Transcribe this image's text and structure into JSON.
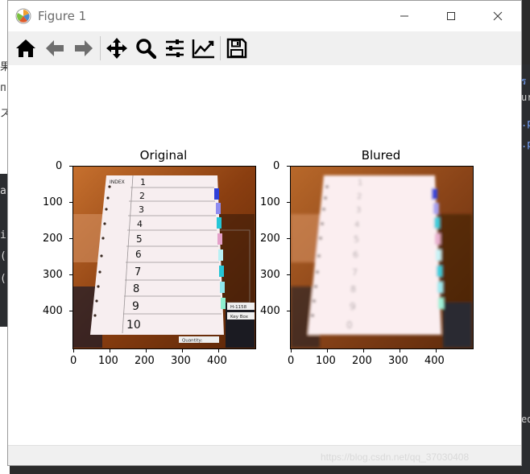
{
  "window": {
    "title": "Figure 1"
  },
  "toolbar": {
    "tools": [
      {
        "name": "home-icon"
      },
      {
        "name": "back-arrow-icon"
      },
      {
        "name": "forward-arrow-icon"
      },
      {
        "name": "pan-move-icon"
      },
      {
        "name": "zoom-magnifier-icon"
      },
      {
        "name": "configure-subplots-icon"
      },
      {
        "name": "edit-axes-icon"
      },
      {
        "name": "save-disk-icon"
      }
    ]
  },
  "figure": {
    "subplots": [
      {
        "title": "Original",
        "xticks": [
          "0",
          "100",
          "200",
          "300",
          "400"
        ],
        "yticks": [
          "0",
          "100",
          "200",
          "300",
          "400"
        ],
        "sheet": {
          "header": "INDEX",
          "tabs": [
            "1",
            "2",
            "3",
            "4",
            "5",
            "6",
            "7",
            "8",
            "9",
            "10"
          ]
        },
        "box_labels": [
          "H-1158",
          "Key Box",
          "Quantity:"
        ]
      },
      {
        "title": "Blured",
        "xticks": [
          "0",
          "100",
          "200",
          "300",
          "400"
        ],
        "yticks": [
          "0",
          "100",
          "200",
          "300",
          "400"
        ]
      }
    ]
  },
  "watermark": "https://blog.csdn.net/qq_37030408",
  "colors": {
    "background_orange": "#8a4a1c",
    "sheet": "#f7eef0",
    "tab_blue": "#2f3fd8",
    "tab_cyan": "#25c6d6",
    "tab_pink": "#e4a0c9"
  }
}
